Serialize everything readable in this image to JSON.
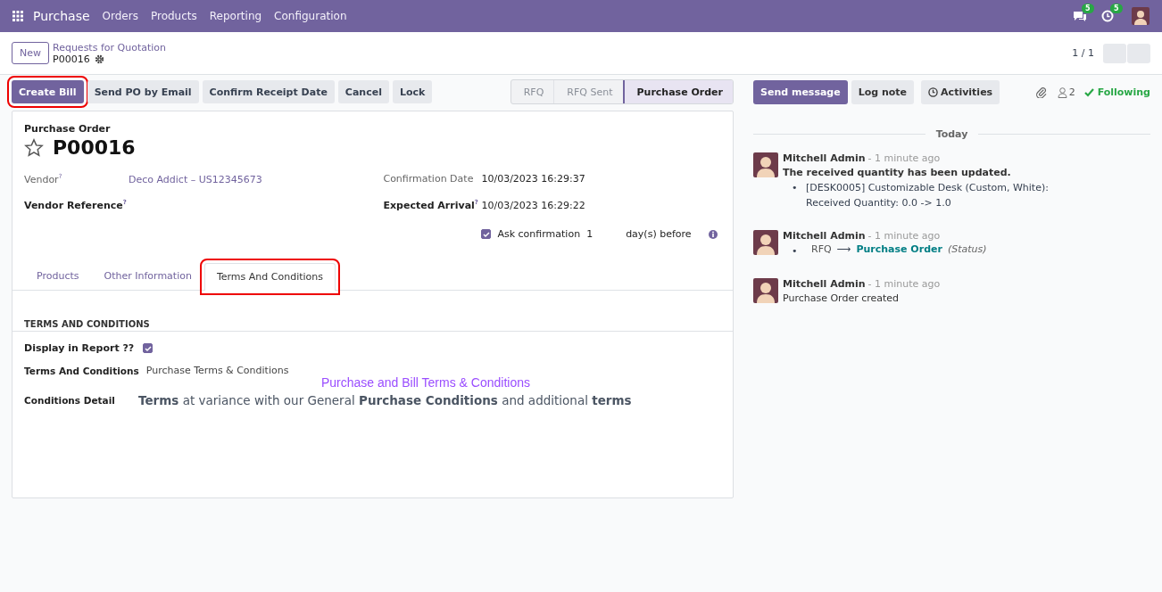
{
  "navbar": {
    "app": "Purchase",
    "menus": [
      "Orders",
      "Products",
      "Reporting",
      "Configuration"
    ],
    "messages_badge": "5",
    "activities_badge": "5"
  },
  "control_panel": {
    "new_button": "New",
    "breadcrumb": "Requests for Quotation",
    "record": "P00016",
    "pager": "1 / 1"
  },
  "actions": [
    {
      "label": "Create Bill",
      "primary": true,
      "highlighted": true
    },
    {
      "label": "Send PO by Email",
      "primary": false,
      "highlighted": false
    },
    {
      "label": "Confirm Receipt Date",
      "primary": false,
      "highlighted": false
    },
    {
      "label": "Cancel",
      "primary": false,
      "highlighted": false
    },
    {
      "label": "Lock",
      "primary": false,
      "highlighted": false
    }
  ],
  "statusbar": [
    {
      "label": "RFQ",
      "selected": false
    },
    {
      "label": "RFQ Sent",
      "selected": false
    },
    {
      "label": "Purchase Order",
      "selected": true
    }
  ],
  "form": {
    "type_label": "Purchase Order",
    "name": "P00016",
    "starred": false,
    "left_fields": [
      {
        "label": "Vendor",
        "tooltip": "?",
        "value": "Deco Addict – US12345673",
        "bold": false,
        "link": true
      },
      {
        "label": "Vendor Reference",
        "tooltip": "?",
        "bold": true
      }
    ],
    "right_fields": [
      {
        "label": "Confirmation Date",
        "value": "10/03/2023 16:29:37",
        "bold": false
      },
      {
        "label": "Expected Arrival",
        "tooltip": "?",
        "value": "10/03/2023 16:29:22",
        "bold": true
      }
    ],
    "ask_confirmation": {
      "checked": true,
      "label": "Ask confirmation",
      "days": "1",
      "suffix": "day(s) before"
    },
    "tabs": [
      {
        "label": "Products",
        "selected": false,
        "highlighted": false
      },
      {
        "label": "Other Information",
        "selected": false,
        "highlighted": false
      },
      {
        "label": "Terms And Conditions",
        "selected": true,
        "highlighted": true
      }
    ],
    "section_title": "TERMS AND CONDITIONS",
    "display_in_report": {
      "label": "Display in Report ??",
      "checked": true
    },
    "terms_label": "Terms And Conditions",
    "terms_value": "Purchase Terms & Conditions",
    "terms_heading": "Purchase and Bill Terms & Conditions",
    "detail_label": "Conditions Detail",
    "detail_text": "**Terms** at variance with our General **Purchase Conditions** and additional **terms**"
  },
  "chatter": {
    "buttons": [
      "Send message",
      "Log note",
      "Activities"
    ],
    "followers": "2",
    "following": "Following",
    "date_separator": "Today",
    "messages": [
      {
        "kind": "update",
        "author": "Mitchell Admin",
        "time": "- 1 minute ago",
        "title": "The received quantity has been updated.",
        "bullet": "•",
        "lines": [
          "[DESK0005] Customizable Desk (Custom, White):",
          "Received Quantity: 0.0 -> 1.0"
        ]
      },
      {
        "kind": "tracking",
        "author": "Mitchell Admin",
        "time": "- 1 minute ago",
        "bullet": "•",
        "old": "RFQ",
        "arrow": "⟶",
        "new": "Purchase Order",
        "field": "(Status)"
      },
      {
        "kind": "plain",
        "author": "Mitchell Admin",
        "time": "- 1 minute ago",
        "body": "Purchase Order created"
      }
    ]
  }
}
